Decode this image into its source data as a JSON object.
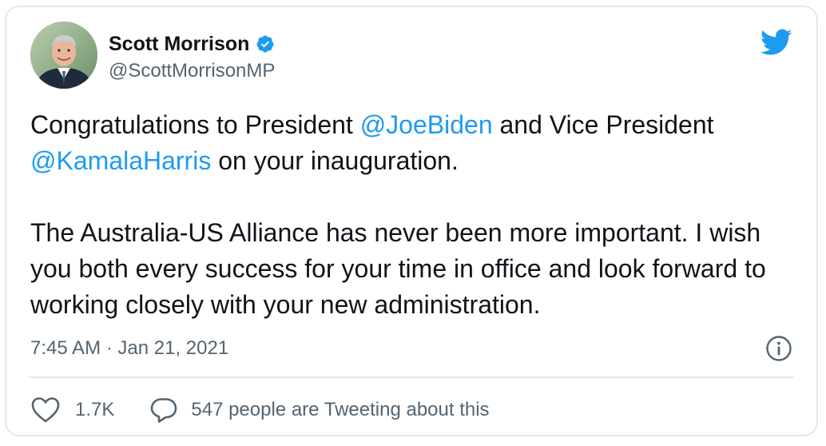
{
  "author": {
    "name": "Scott Morrison",
    "handle": "@ScottMorrisonMP",
    "verified": true
  },
  "tweet": {
    "line1_before": "Congratulations to President ",
    "mention1": "@JoeBiden",
    "line1_after": " and Vice President",
    "mention2": "@KamalaHarris",
    "line2_after": " on your inauguration.",
    "paragraph2": "The Australia-US Alliance has never been more important. I wish you both every success for your time in office and look forward to working closely with your new administration."
  },
  "timestamp": "7:45 AM · Jan 21, 2021",
  "engagement": {
    "likes": "1.7K",
    "conversation": "547 people are Tweeting about this"
  },
  "colors": {
    "accent": "#1d9bf0",
    "text": "#0f1419",
    "secondary": "#536471",
    "border": "#e1e8ed"
  },
  "icons": {
    "verified": "verified-badge-icon",
    "brand": "twitter-bird-icon",
    "info": "info-icon",
    "like": "heart-icon",
    "reply": "speech-bubble-icon"
  }
}
